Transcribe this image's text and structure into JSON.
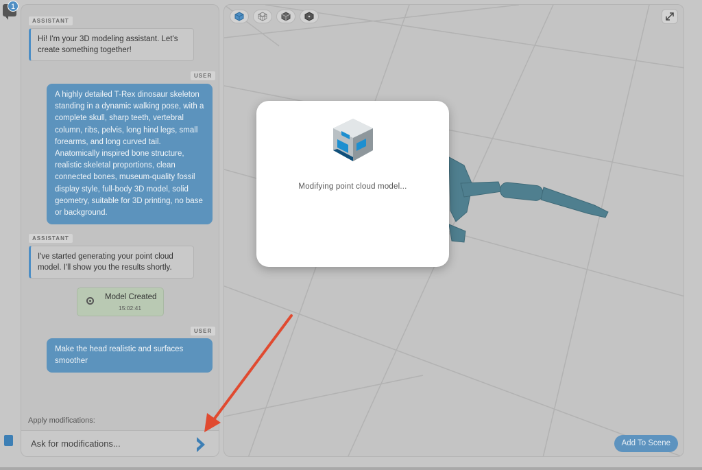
{
  "rail": {
    "notification_count": "1"
  },
  "chat": {
    "messages": [
      {
        "role": "ASSISTANT",
        "text": "Hi! I'm your 3D modeling assistant. Let's create something together!"
      },
      {
        "role": "USER",
        "text": "A highly detailed T-Rex dinosaur skeleton standing in a dynamic walking pose, with a complete skull, sharp teeth, vertebral column, ribs, pelvis, long hind legs, small forearms, and long curved tail. Anatomically inspired bone structure, realistic skeletal proportions, clean connected bones, museum-quality fossil display style, full-body 3D model, solid geometry, suitable for 3D printing, no base or background."
      },
      {
        "role": "ASSISTANT",
        "text": "I've started generating your point cloud model. I'll show you the results shortly."
      },
      {
        "role": "USER",
        "text": "Make the head realistic and surfaces smoother"
      }
    ],
    "status_card": {
      "title": "Model Created",
      "time": "15:02:41"
    },
    "apply_label": "Apply modifications:",
    "input_placeholder": "Ask for modifications..."
  },
  "viewer": {
    "toolbar_icons": [
      "solid-cube-icon",
      "wireframe-cube-icon",
      "shaded-cube-icon",
      "point-cube-icon"
    ],
    "add_to_scene_label": "Add To Scene",
    "model_color": "#4f7f8f"
  },
  "modal": {
    "message": "Modifying point cloud model..."
  },
  "colors": {
    "accent": "#4f8fc4",
    "user_bubble": "#5c93bd",
    "arrow": "#e04a30"
  }
}
